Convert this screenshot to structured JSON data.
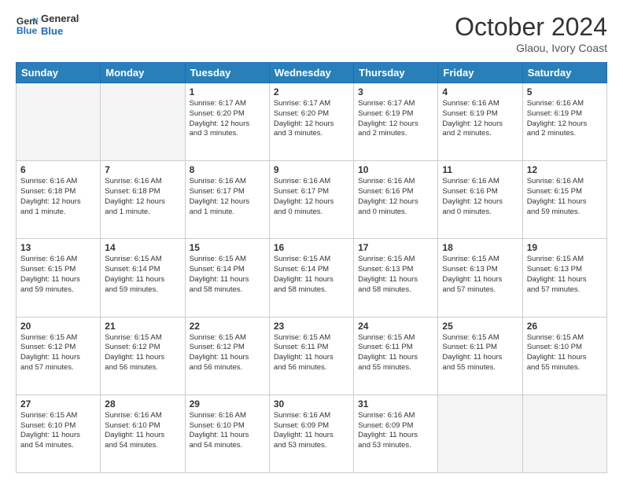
{
  "logo": {
    "line1": "General",
    "line2": "Blue"
  },
  "header": {
    "month": "October 2024",
    "location": "Glaou, Ivory Coast"
  },
  "weekdays": [
    "Sunday",
    "Monday",
    "Tuesday",
    "Wednesday",
    "Thursday",
    "Friday",
    "Saturday"
  ],
  "weeks": [
    [
      {
        "day": "",
        "text": ""
      },
      {
        "day": "",
        "text": ""
      },
      {
        "day": "1",
        "text": "Sunrise: 6:17 AM\nSunset: 6:20 PM\nDaylight: 12 hours\nand 3 minutes."
      },
      {
        "day": "2",
        "text": "Sunrise: 6:17 AM\nSunset: 6:20 PM\nDaylight: 12 hours\nand 3 minutes."
      },
      {
        "day": "3",
        "text": "Sunrise: 6:17 AM\nSunset: 6:19 PM\nDaylight: 12 hours\nand 2 minutes."
      },
      {
        "day": "4",
        "text": "Sunrise: 6:16 AM\nSunset: 6:19 PM\nDaylight: 12 hours\nand 2 minutes."
      },
      {
        "day": "5",
        "text": "Sunrise: 6:16 AM\nSunset: 6:19 PM\nDaylight: 12 hours\nand 2 minutes."
      }
    ],
    [
      {
        "day": "6",
        "text": "Sunrise: 6:16 AM\nSunset: 6:18 PM\nDaylight: 12 hours\nand 1 minute."
      },
      {
        "day": "7",
        "text": "Sunrise: 6:16 AM\nSunset: 6:18 PM\nDaylight: 12 hours\nand 1 minute."
      },
      {
        "day": "8",
        "text": "Sunrise: 6:16 AM\nSunset: 6:17 PM\nDaylight: 12 hours\nand 1 minute."
      },
      {
        "day": "9",
        "text": "Sunrise: 6:16 AM\nSunset: 6:17 PM\nDaylight: 12 hours\nand 0 minutes."
      },
      {
        "day": "10",
        "text": "Sunrise: 6:16 AM\nSunset: 6:16 PM\nDaylight: 12 hours\nand 0 minutes."
      },
      {
        "day": "11",
        "text": "Sunrise: 6:16 AM\nSunset: 6:16 PM\nDaylight: 12 hours\nand 0 minutes."
      },
      {
        "day": "12",
        "text": "Sunrise: 6:16 AM\nSunset: 6:15 PM\nDaylight: 11 hours\nand 59 minutes."
      }
    ],
    [
      {
        "day": "13",
        "text": "Sunrise: 6:16 AM\nSunset: 6:15 PM\nDaylight: 11 hours\nand 59 minutes."
      },
      {
        "day": "14",
        "text": "Sunrise: 6:15 AM\nSunset: 6:14 PM\nDaylight: 11 hours\nand 59 minutes."
      },
      {
        "day": "15",
        "text": "Sunrise: 6:15 AM\nSunset: 6:14 PM\nDaylight: 11 hours\nand 58 minutes."
      },
      {
        "day": "16",
        "text": "Sunrise: 6:15 AM\nSunset: 6:14 PM\nDaylight: 11 hours\nand 58 minutes."
      },
      {
        "day": "17",
        "text": "Sunrise: 6:15 AM\nSunset: 6:13 PM\nDaylight: 11 hours\nand 58 minutes."
      },
      {
        "day": "18",
        "text": "Sunrise: 6:15 AM\nSunset: 6:13 PM\nDaylight: 11 hours\nand 57 minutes."
      },
      {
        "day": "19",
        "text": "Sunrise: 6:15 AM\nSunset: 6:13 PM\nDaylight: 11 hours\nand 57 minutes."
      }
    ],
    [
      {
        "day": "20",
        "text": "Sunrise: 6:15 AM\nSunset: 6:12 PM\nDaylight: 11 hours\nand 57 minutes."
      },
      {
        "day": "21",
        "text": "Sunrise: 6:15 AM\nSunset: 6:12 PM\nDaylight: 11 hours\nand 56 minutes."
      },
      {
        "day": "22",
        "text": "Sunrise: 6:15 AM\nSunset: 6:12 PM\nDaylight: 11 hours\nand 56 minutes."
      },
      {
        "day": "23",
        "text": "Sunrise: 6:15 AM\nSunset: 6:11 PM\nDaylight: 11 hours\nand 56 minutes."
      },
      {
        "day": "24",
        "text": "Sunrise: 6:15 AM\nSunset: 6:11 PM\nDaylight: 11 hours\nand 55 minutes."
      },
      {
        "day": "25",
        "text": "Sunrise: 6:15 AM\nSunset: 6:11 PM\nDaylight: 11 hours\nand 55 minutes."
      },
      {
        "day": "26",
        "text": "Sunrise: 6:15 AM\nSunset: 6:10 PM\nDaylight: 11 hours\nand 55 minutes."
      }
    ],
    [
      {
        "day": "27",
        "text": "Sunrise: 6:15 AM\nSunset: 6:10 PM\nDaylight: 11 hours\nand 54 minutes."
      },
      {
        "day": "28",
        "text": "Sunrise: 6:16 AM\nSunset: 6:10 PM\nDaylight: 11 hours\nand 54 minutes."
      },
      {
        "day": "29",
        "text": "Sunrise: 6:16 AM\nSunset: 6:10 PM\nDaylight: 11 hours\nand 54 minutes."
      },
      {
        "day": "30",
        "text": "Sunrise: 6:16 AM\nSunset: 6:09 PM\nDaylight: 11 hours\nand 53 minutes."
      },
      {
        "day": "31",
        "text": "Sunrise: 6:16 AM\nSunset: 6:09 PM\nDaylight: 11 hours\nand 53 minutes."
      },
      {
        "day": "",
        "text": ""
      },
      {
        "day": "",
        "text": ""
      }
    ]
  ]
}
